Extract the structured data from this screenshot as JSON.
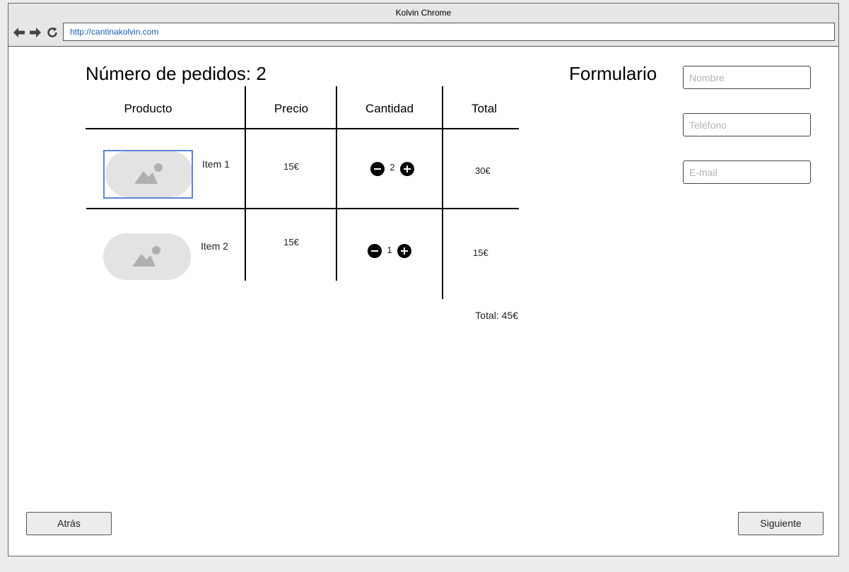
{
  "window": {
    "title": "Kolvin Chrome"
  },
  "browser": {
    "url": "http://cantinakolvin.com"
  },
  "orders": {
    "heading": "Número de pedidos: 2",
    "columns": [
      "Producto",
      "Precio",
      "Cantidad",
      "Total"
    ],
    "rows": [
      {
        "name": "Item 1",
        "price": "15€",
        "quantity": "2",
        "total": "30€"
      },
      {
        "name": "Item 2",
        "price": "15€",
        "quantity": "1",
        "total": "15€"
      }
    ],
    "grand_total": "Total: 45€"
  },
  "form": {
    "heading": "Formulario",
    "fields": [
      {
        "placeholder": "Nombre"
      },
      {
        "placeholder": "Teléfono"
      },
      {
        "placeholder": "E-mail"
      }
    ]
  },
  "actions": {
    "back_label": "Atrás",
    "next_label": "Siguiente"
  },
  "icons": [
    "arrow-left-icon",
    "arrow-right-icon",
    "reload-icon",
    "image-placeholder-icon",
    "minus-circle-icon",
    "plus-circle-icon"
  ],
  "colors": {
    "selection_border": "#5b86d6",
    "url_text": "#1a5fb4",
    "thumbnail_bg": "#e3e3e3"
  }
}
